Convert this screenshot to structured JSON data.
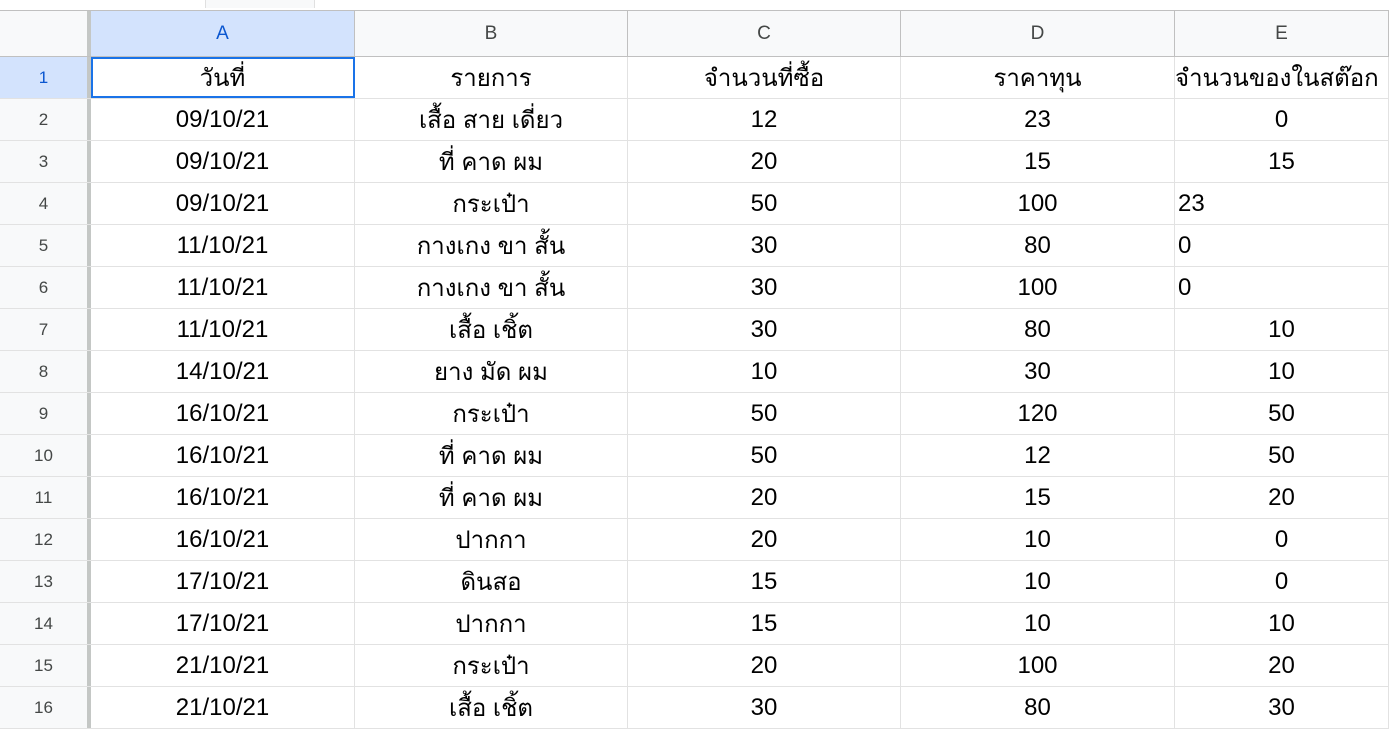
{
  "columns": [
    "A",
    "B",
    "C",
    "D",
    "E"
  ],
  "rows": [
    {
      "num": "1",
      "cells": [
        "วันที่",
        "รายการ",
        "จำนวนที่ซื้อ",
        "ราคาทุน",
        "จำนวนของในสต๊อก"
      ]
    },
    {
      "num": "2",
      "cells": [
        "09/10/21",
        "เสื้อ สาย เดี่ยว",
        "12",
        "23",
        "0"
      ]
    },
    {
      "num": "3",
      "cells": [
        "09/10/21",
        "ที่ คาด ผม",
        "20",
        "15",
        "15"
      ]
    },
    {
      "num": "4",
      "cells": [
        "09/10/21",
        "กระเป๋า",
        "50",
        "100",
        "23"
      ]
    },
    {
      "num": "5",
      "cells": [
        "11/10/21",
        "กางเกง ขา สั้น",
        "30",
        "80",
        "0"
      ]
    },
    {
      "num": "6",
      "cells": [
        "11/10/21",
        "กางเกง ขา สั้น",
        "30",
        "100",
        "0"
      ]
    },
    {
      "num": "7",
      "cells": [
        "11/10/21",
        "เสื้อ เชิ้ต",
        "30",
        "80",
        "10"
      ]
    },
    {
      "num": "8",
      "cells": [
        "14/10/21",
        "ยาง มัด ผม",
        "10",
        "30",
        "10"
      ]
    },
    {
      "num": "9",
      "cells": [
        "16/10/21",
        "กระเป๋า",
        "50",
        "120",
        "50"
      ]
    },
    {
      "num": "10",
      "cells": [
        "16/10/21",
        "ที่ คาด ผม",
        "50",
        "12",
        "50"
      ]
    },
    {
      "num": "11",
      "cells": [
        "16/10/21",
        "ที่ คาด ผม",
        "20",
        "15",
        "20"
      ]
    },
    {
      "num": "12",
      "cells": [
        "16/10/21",
        "ปากกา",
        "20",
        "10",
        "0"
      ]
    },
    {
      "num": "13",
      "cells": [
        "17/10/21",
        "ดินสอ",
        "15",
        "10",
        "0"
      ]
    },
    {
      "num": "14",
      "cells": [
        "17/10/21",
        "ปากกา",
        "15",
        "10",
        "10"
      ]
    },
    {
      "num": "15",
      "cells": [
        "21/10/21",
        "กระเป๋า",
        "20",
        "100",
        "20"
      ]
    },
    {
      "num": "16",
      "cells": [
        "21/10/21",
        "เสื้อ เชิ้ต",
        "30",
        "80",
        "30"
      ]
    }
  ],
  "left_aligned_cells": [
    [
      4,
      4
    ],
    [
      5,
      4
    ],
    [
      6,
      4
    ]
  ],
  "active_cell": {
    "row": 1,
    "col": "A"
  },
  "colors": {
    "selection_outline": "#1a73e8",
    "selected_header_bg": "#d3e3fd",
    "header_bg": "#f8f9fa"
  }
}
